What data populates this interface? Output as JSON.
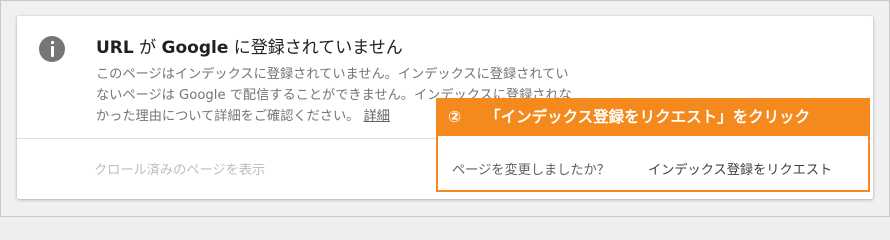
{
  "card": {
    "icon": "info-icon",
    "title": {
      "part1": "URL",
      "part2": " が ",
      "part3": "Google",
      "part4": " に登録されていません"
    },
    "description_lines": [
      "このページはインデックスに登録されていません。インデックスに登録されてい",
      "ないページは Google で配信することができません。インデックスに登録されな",
      "かった理由について詳細をご確認ください。"
    ],
    "details_link": "詳細",
    "crawled_page_link": "クロール済みのページを表示"
  },
  "callout": {
    "step": "②",
    "instruction": "「インデックス登録をリクエスト」をクリック",
    "accent_color": "#f48a1e"
  },
  "actions": {
    "changed_question": "ページを変更しましたか？",
    "request_indexing": "インデックス登録をリクエスト"
  }
}
